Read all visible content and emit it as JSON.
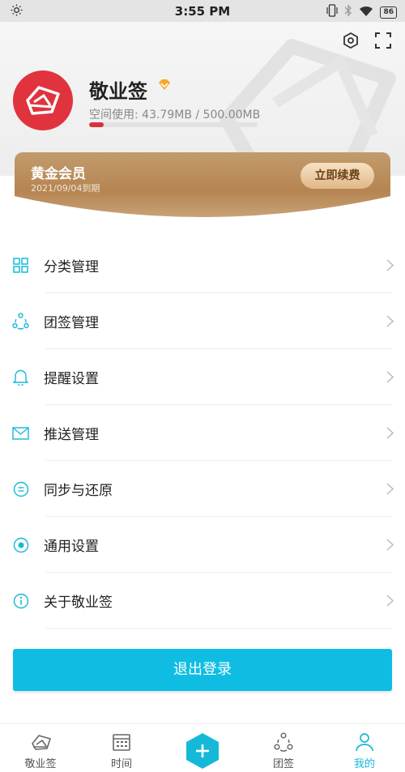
{
  "status_bar": {
    "time": "3:55 PM",
    "battery": "86",
    "icons": [
      "brightness-icon",
      "vibrate-icon",
      "bluetooth-icon",
      "wifi-icon",
      "battery-icon"
    ]
  },
  "header": {
    "icons": [
      "settings-icon",
      "fullscreen-icon"
    ],
    "username": "敬业签",
    "storage_text": "空间使用: 43.79MB / 500.00MB",
    "storage_fraction": 0.0876
  },
  "membership": {
    "title": "黄金会员",
    "expiry": "2021/09/04到期",
    "renew_label": "立即续费"
  },
  "menu": {
    "items": [
      {
        "label": "分类管理",
        "icon": "category-icon"
      },
      {
        "label": "团签管理",
        "icon": "team-icon"
      },
      {
        "label": "提醒设置",
        "icon": "bell-icon"
      },
      {
        "label": "推送管理",
        "icon": "mail-icon"
      },
      {
        "label": "同步与还原",
        "icon": "sync-icon"
      },
      {
        "label": "通用设置",
        "icon": "general-icon"
      },
      {
        "label": "关于敬业签",
        "icon": "info-icon"
      }
    ]
  },
  "logout_label": "退出登录",
  "bottom_nav": {
    "items": [
      {
        "label": "敬业签",
        "icon": "home-note-icon"
      },
      {
        "label": "时间",
        "icon": "calendar-icon"
      },
      {
        "label": "团签",
        "icon": "team-icon"
      },
      {
        "label": "我的",
        "icon": "profile-icon",
        "active": true
      }
    ],
    "add_icon": "add-icon"
  },
  "colors": {
    "accent": "#0fbde2",
    "brand_red": "#e0333e",
    "gold": "#b58551"
  }
}
